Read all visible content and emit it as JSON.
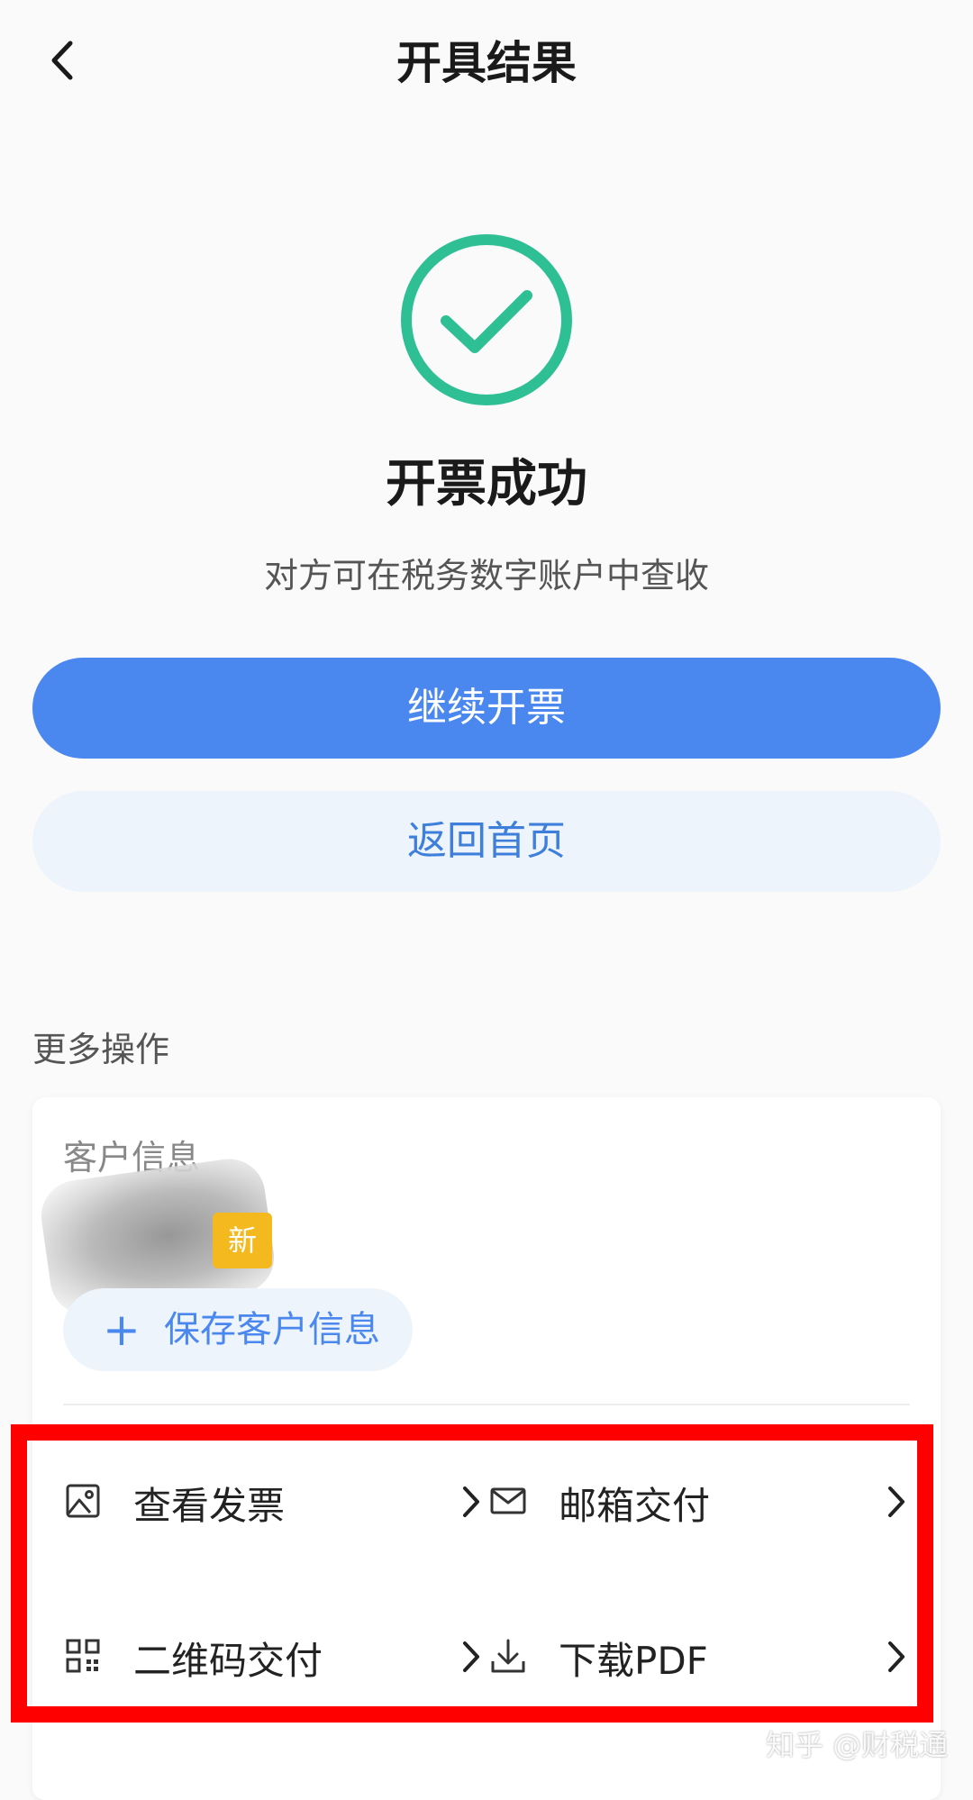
{
  "header": {
    "title": "开具结果",
    "back_icon": "chevron-left-icon"
  },
  "result": {
    "status": "开票成功",
    "subtitle": "对方可在税务数字账户中查收",
    "icon": "check-circle-icon",
    "icon_color": "#2fbf95"
  },
  "actions": {
    "primary_label": "继续开票",
    "secondary_label": "返回首页",
    "primary_color": "#4a87ef"
  },
  "more": {
    "section_title": "更多操作",
    "customer_label": "客户信息",
    "new_badge": "新",
    "save_label": "保存客户信息",
    "ops": [
      {
        "label": "查看发票",
        "icon": "image-icon"
      },
      {
        "label": "邮箱交付",
        "icon": "mail-icon"
      },
      {
        "label": "二维码交付",
        "icon": "qrcode-icon"
      },
      {
        "label": "下载PDF",
        "icon": "download-icon"
      }
    ]
  },
  "watermark": "知乎 @财税通"
}
